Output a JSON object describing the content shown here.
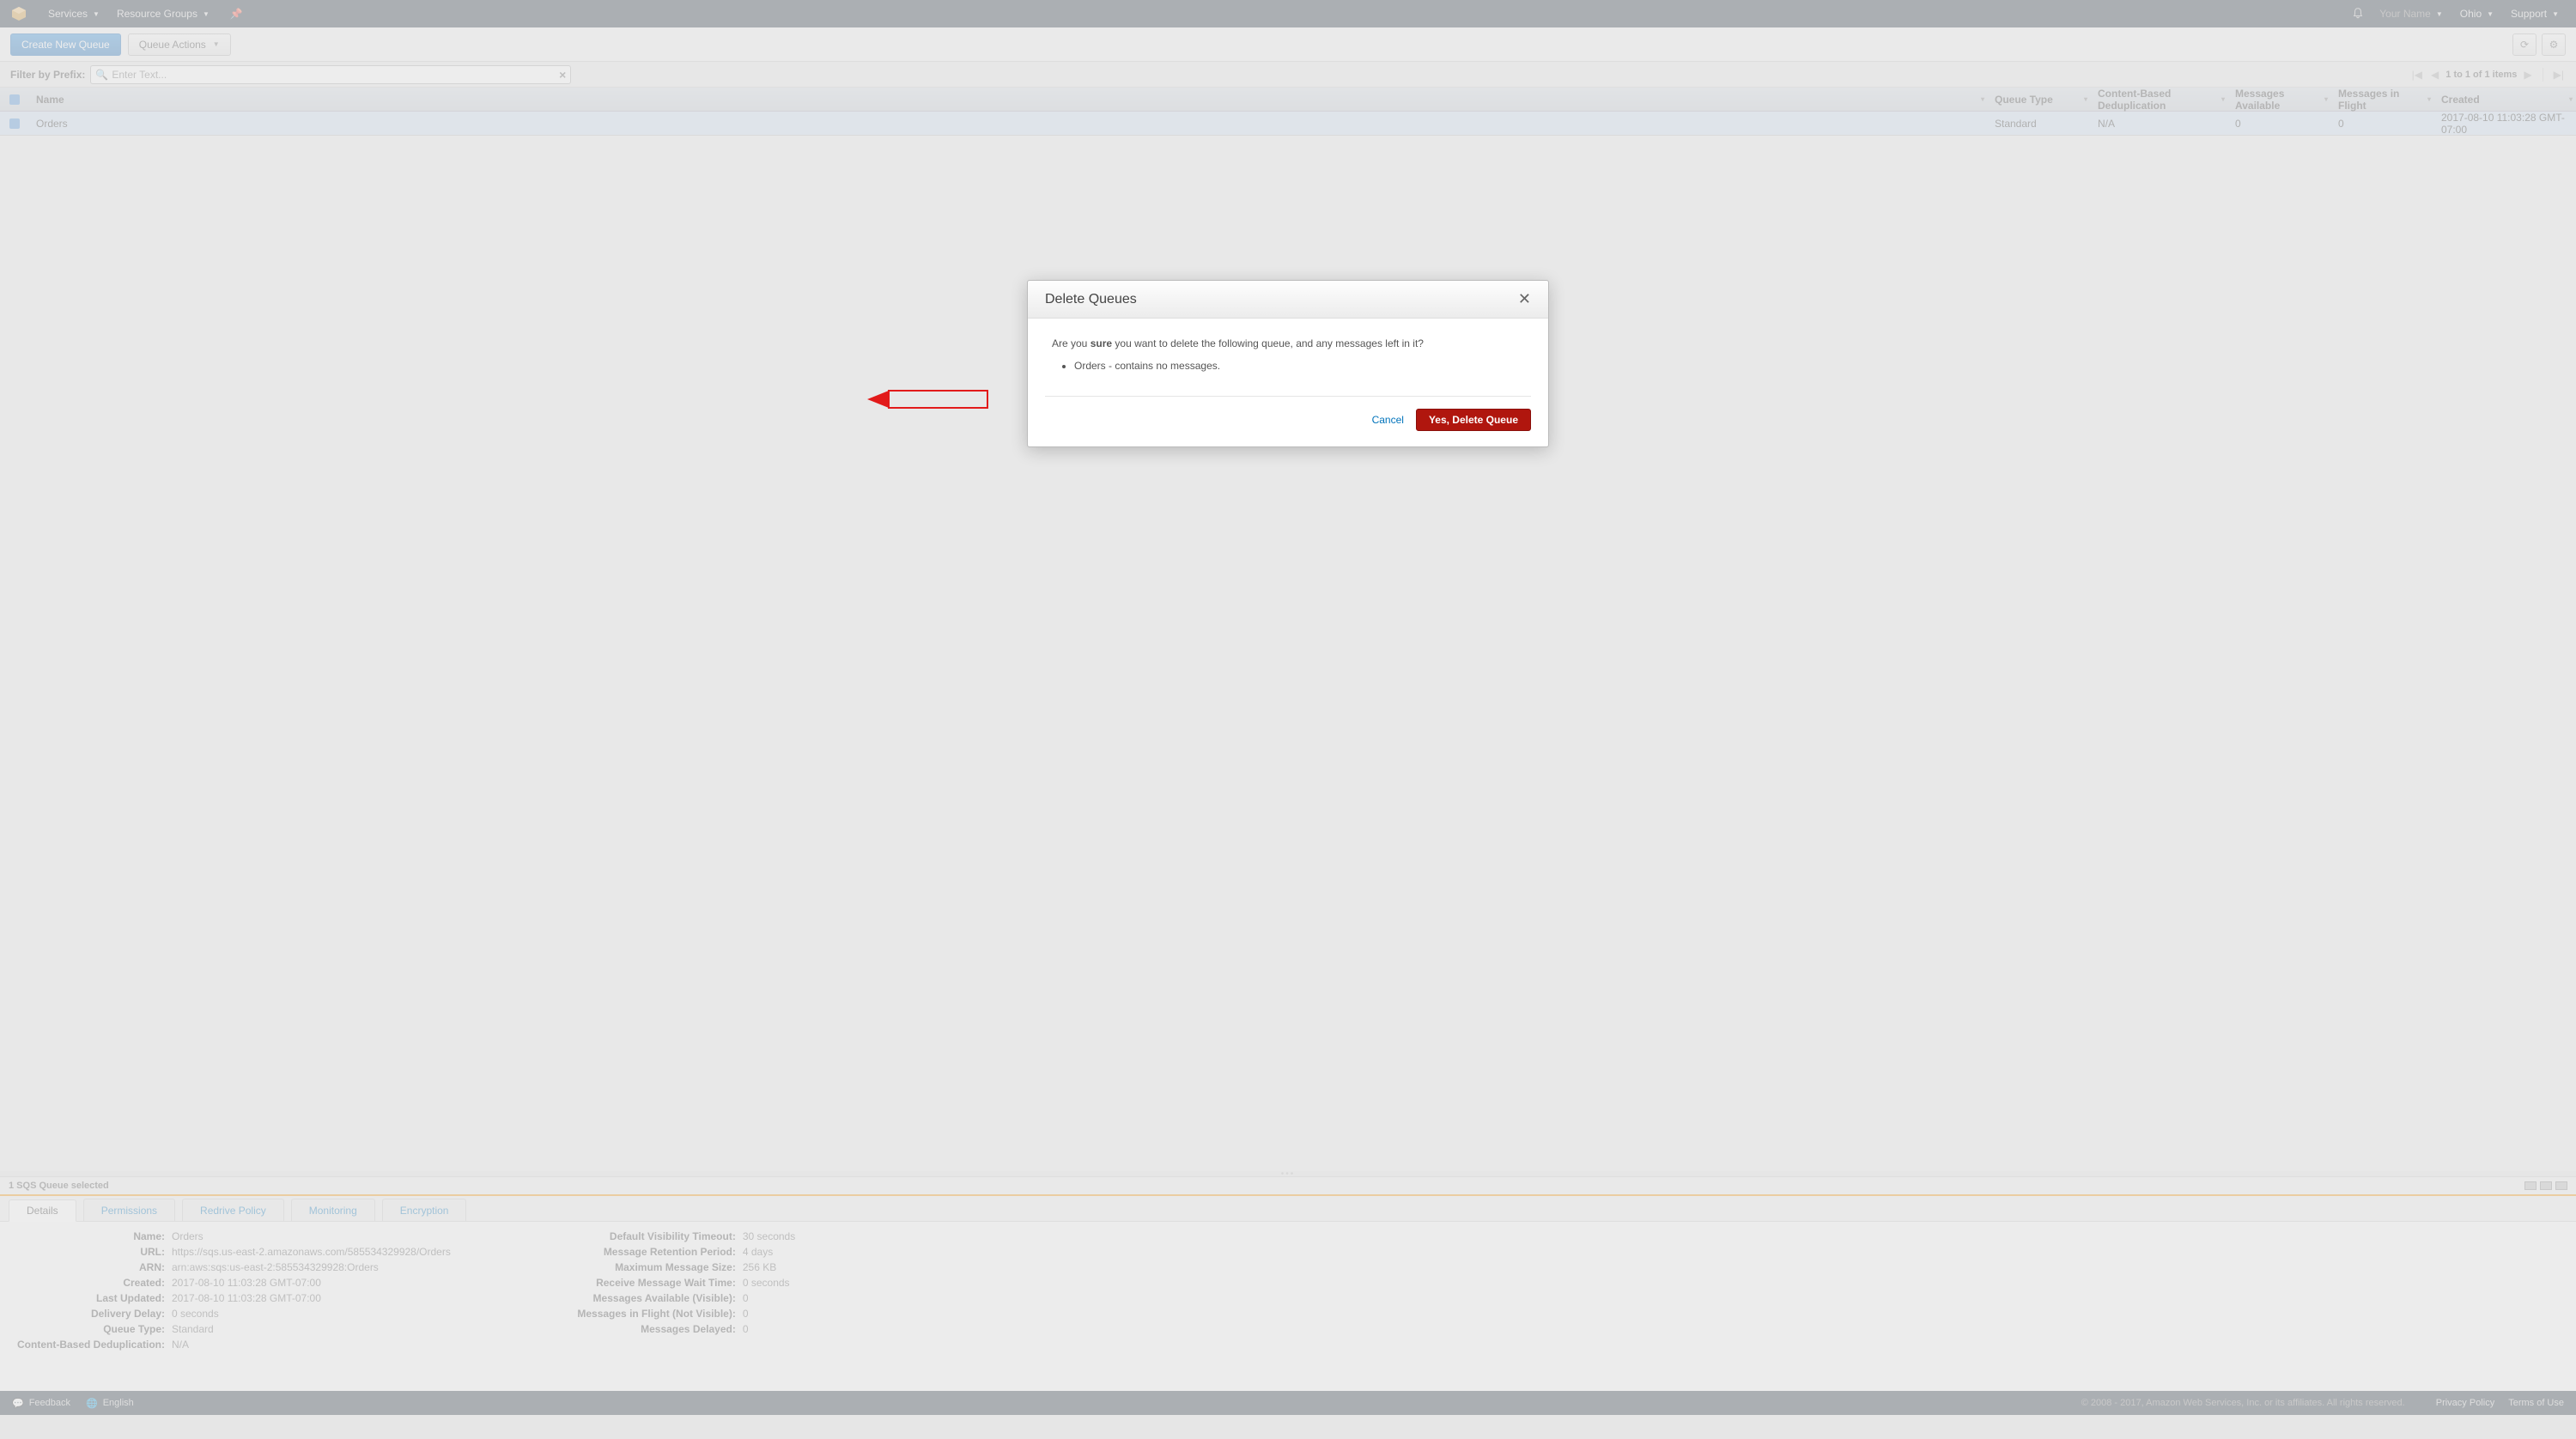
{
  "topnav": {
    "services": "Services",
    "resource_groups": "Resource Groups",
    "your_name": "Your Name",
    "region": "Ohio",
    "support": "Support"
  },
  "toolbar": {
    "create": "Create New Queue",
    "actions": "Queue Actions"
  },
  "filter": {
    "label": "Filter by Prefix:",
    "placeholder": "Enter Text...",
    "pager": "1 to 1 of 1 items"
  },
  "table": {
    "headers": {
      "name": "Name",
      "type": "Queue Type",
      "dedup": "Content-Based Deduplication",
      "avail": "Messages Available",
      "flight": "Messages in Flight",
      "created": "Created"
    },
    "row": {
      "name": "Orders",
      "type": "Standard",
      "dedup": "N/A",
      "avail": "0",
      "flight": "0",
      "created": "2017-08-10 11:03:28 GMT-07:00"
    }
  },
  "details": {
    "selected": "1 SQS Queue selected",
    "tabs": {
      "details": "Details",
      "permissions": "Permissions",
      "redrive": "Redrive Policy",
      "monitoring": "Monitoring",
      "encryption": "Encryption"
    },
    "left": {
      "name_k": "Name:",
      "name_v": "Orders",
      "url_k": "URL:",
      "url_v": "https://sqs.us-east-2.amazonaws.com/585534329928/Orders",
      "arn_k": "ARN:",
      "arn_v": "arn:aws:sqs:us-east-2:585534329928:Orders",
      "created_k": "Created:",
      "created_v": "2017-08-10 11:03:28 GMT-07:00",
      "updated_k": "Last Updated:",
      "updated_v": "2017-08-10 11:03:28 GMT-07:00",
      "delay_k": "Delivery Delay:",
      "delay_v": "0 seconds",
      "qtype_k": "Queue Type:",
      "qtype_v": "Standard",
      "cbd_k": "Content-Based Deduplication:",
      "cbd_v": "N/A"
    },
    "right": {
      "vis_k": "Default Visibility Timeout:",
      "vis_v": "30 seconds",
      "ret_k": "Message Retention Period:",
      "ret_v": "4 days",
      "max_k": "Maximum Message Size:",
      "max_v": "256 KB",
      "wait_k": "Receive Message Wait Time:",
      "wait_v": "0 seconds",
      "availv_k": "Messages Available (Visible):",
      "availv_v": "0",
      "flightn_k": "Messages in Flight (Not Visible):",
      "flightn_v": "0",
      "delayed_k": "Messages Delayed:",
      "delayed_v": "0"
    }
  },
  "dialog": {
    "title": "Delete Queues",
    "q_pre": "Are you ",
    "q_sure": "sure",
    "q_post": " you want to delete the following queue, and any messages left in it?",
    "item": "Orders - contains no messages.",
    "cancel": "Cancel",
    "confirm": "Yes, Delete Queue"
  },
  "footer": {
    "feedback": "Feedback",
    "language": "English",
    "copy": "© 2008 - 2017, Amazon Web Services, Inc. or its affiliates. All rights reserved.",
    "privacy": "Privacy Policy",
    "terms": "Terms of Use"
  }
}
